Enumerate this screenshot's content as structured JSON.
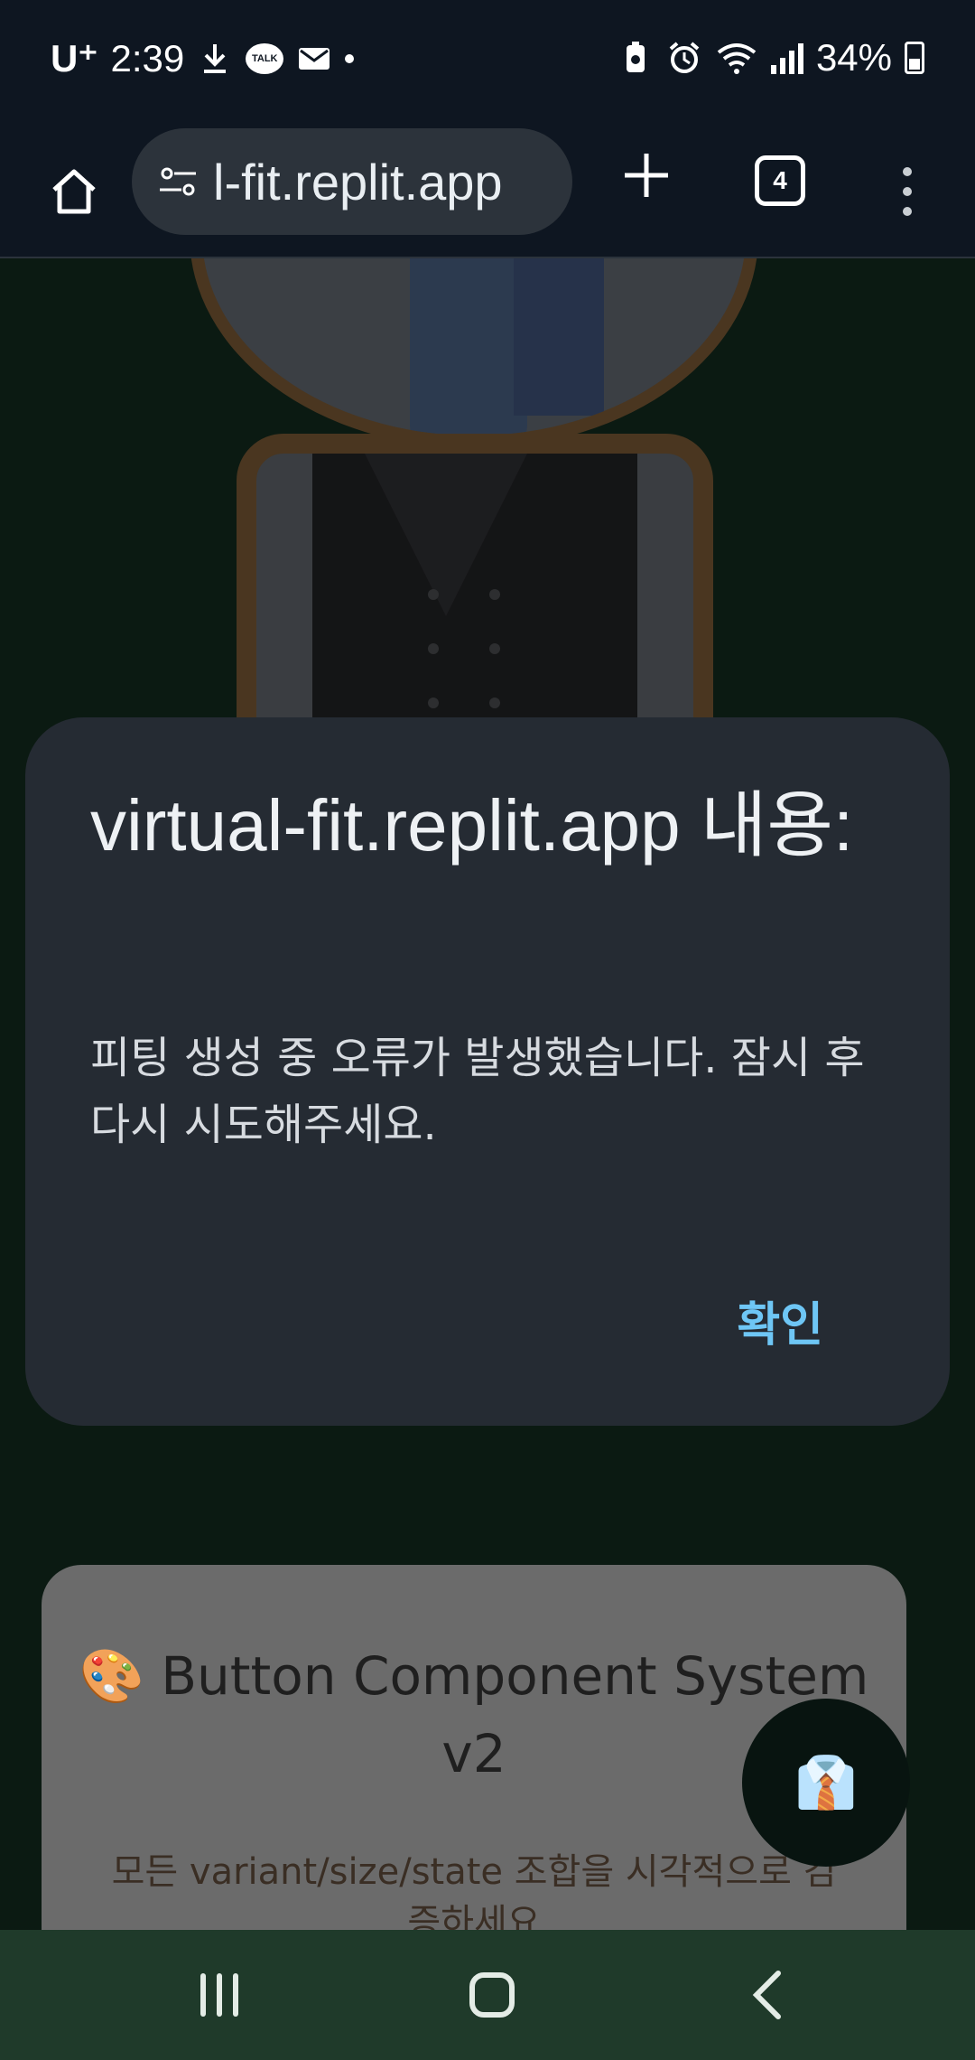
{
  "status_bar": {
    "carrier": "U⁺",
    "time": "2:39",
    "talk_label": "TALK",
    "battery_percent": "34%"
  },
  "browser": {
    "url_display": "l-fit.replit.app",
    "tab_count": "4"
  },
  "page": {
    "hint_text": "",
    "card_title": "🎨 Button Component System v2",
    "card_desc": "모든 variant/size/state 조합을 시각적으로 검증하세요",
    "fab_icon": "👔"
  },
  "dialog": {
    "title": "virtual-fit.replit.app 내용:",
    "message": "피팅 생성 중 오류가 발생했습니다. 잠시 후 다시 시도해주세요.",
    "ok_label": "확인"
  },
  "colors": {
    "dialog_bg": "#252b33",
    "accent": "#6ec6f5",
    "nav_bg": "#1f3a2a"
  }
}
